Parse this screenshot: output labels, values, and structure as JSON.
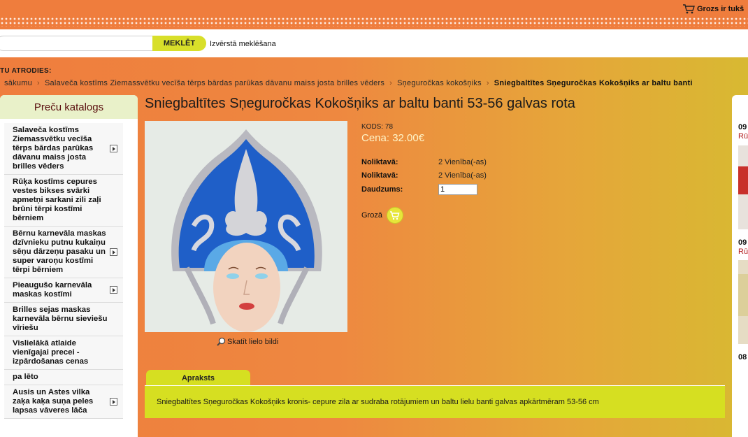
{
  "header": {
    "cart_label": "Grozs ir tukš"
  },
  "search": {
    "input_value": "",
    "button_label": "MEKLĒT",
    "advanced_label": "Izvērstā meklēšana"
  },
  "breadcrumb": {
    "you_are_label": "TU ATRODIES:",
    "items": [
      "sākumu",
      "Salaveča kostīms Ziemassvētku vecīša tērps bārdas parūkas dāvanu maiss josta brilles vēders",
      "Sņeguročkas kokošņiks"
    ],
    "current": "Sniegbaltītes Sņeguročkas Kokošņiks ar baltu banti"
  },
  "catalog": {
    "title": "Preču katalogs",
    "items": [
      {
        "label": "Salaveča kostīms Ziemassvētku vecīša tērps bārdas parūkas dāvanu maiss josta brilles vēders",
        "has_sub": true
      },
      {
        "label": "Rūķa kostīms cepures vestes bikses svārki apmetņi sarkani zili zaļi brūni tērpi kostīmi bērniem",
        "has_sub": false
      },
      {
        "label": "Bērnu karnevāla maskas dzīvnieku putnu kukaiņu sēņu dārzeņu pasaku un super varoņu kostīmi tērpi bērniem",
        "has_sub": true
      },
      {
        "label": "Pieaugušo karnevāla maskas kostīmi",
        "has_sub": true
      },
      {
        "label": "Brilles sejas maskas karnevāla bērnu sieviešu vīriešu",
        "has_sub": false
      },
      {
        "label": "Vislielākā atlaide vienīgajai precei - izpārdošanas cenas",
        "has_sub": false
      },
      {
        "label": "pa lēto",
        "has_sub": false
      },
      {
        "label": "Ausis un Astes vilka zaķa kaķa suņa peles lapsas vāveres lāča",
        "has_sub": true
      }
    ]
  },
  "product": {
    "title": "Sniegbaltītes Sņeguročkas Kokošņiks ar baltu banti 53-56 galvas rota",
    "code": "KODS: 78",
    "price": "Cena: 32.00€",
    "enlarge_label": "Skatīt lielo bildi",
    "stock_rows": [
      {
        "label": "Noliktavā:",
        "value": "2 Vienība(-as)"
      },
      {
        "label": "Noliktavā:",
        "value": "2 Vienība(-as)"
      }
    ],
    "quantity_label": "Daudzums:",
    "quantity_value": "1",
    "add_to_cart_label": "Grozā"
  },
  "description": {
    "tab_label": "Apraksts",
    "text": "Sniegbaltītes Sņeguročkas Kokošņiks kronis- cepure zila ar sudraba rotājumiem un baltu lielu banti galvas apkārtmēram 53-56 cm"
  },
  "right_column": {
    "entries": [
      {
        "date": "09",
        "link": "Rū"
      },
      {
        "date": "09",
        "link": "Rū"
      },
      {
        "date": "08",
        "link": ""
      }
    ]
  },
  "colors": {
    "accent_green": "#d6df21",
    "orange": "#ef7d3d",
    "price_text": "#fff5c8"
  }
}
